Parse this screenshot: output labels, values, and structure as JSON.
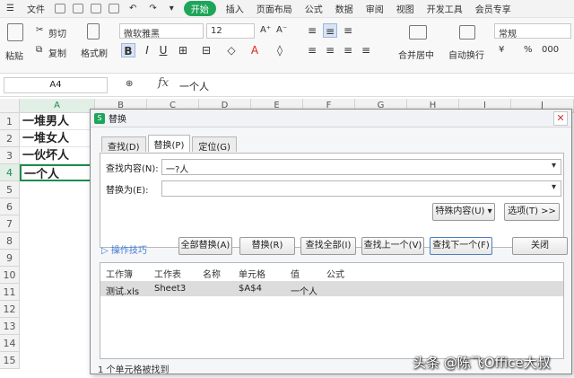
{
  "menubar": {
    "file": "文件",
    "tabs": [
      "开始",
      "插入",
      "页面布局",
      "公式",
      "数据",
      "审阅",
      "视图",
      "开发工具",
      "会员专享"
    ]
  },
  "ribbon": {
    "paste": "粘贴",
    "cut": "剪切",
    "copy": "复制",
    "format_painter": "格式刷",
    "font_name": "微软雅黑",
    "font_size": "12",
    "bold": "B",
    "italic": "I",
    "underline": "U",
    "merge_center": "合并居中",
    "wrap_text": "自动换行",
    "number_format": "常规",
    "currency": "¥",
    "percent": "%",
    "thousands": "000"
  },
  "formula_bar": {
    "cell_ref": "A4",
    "fx": "fx",
    "value": "一个人"
  },
  "sheet": {
    "columns": [
      "A",
      "B",
      "C",
      "D",
      "E",
      "F",
      "G",
      "H",
      "I",
      "J"
    ],
    "rows": [
      "1",
      "2",
      "3",
      "4",
      "5",
      "6",
      "7",
      "8",
      "9",
      "10",
      "11",
      "12",
      "13",
      "14",
      "15"
    ],
    "cells": [
      "一堆男人",
      "一堆女人",
      "一伙坏人",
      "一个人"
    ]
  },
  "dialog": {
    "title": "替换",
    "tabs": [
      "查找(D)",
      "替换(P)",
      "定位(G)"
    ],
    "find_label": "查找内容(N):",
    "find_value": "一?人",
    "replace_label": "替换为(E):",
    "replace_value": "",
    "special_button": "特殊内容(U) ▾",
    "options_button": "选项(T) >>",
    "tips_link": "操作技巧",
    "replace_all": "全部替换(A)",
    "replace": "替换(R)",
    "find_all": "查找全部(I)",
    "find_prev": "查找上一个(V)",
    "find_next": "查找下一个(F)",
    "close": "关闭",
    "result_headers": [
      "工作簿",
      "工作表",
      "名称",
      "单元格",
      "值",
      "公式"
    ],
    "result_row": [
      "测试.xls",
      "Sheet3",
      "",
      "$A$4",
      "一个人",
      ""
    ],
    "status": "1 个单元格被找到"
  },
  "watermark": "头条 @陈飞Office大叔",
  "colors": {
    "accent": "#1fa55a",
    "selection": "#1e8c4e",
    "link": "#3d7ad4"
  }
}
